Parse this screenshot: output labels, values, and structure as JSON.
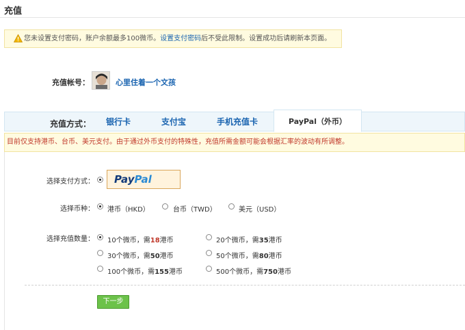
{
  "page": {
    "title": "充值"
  },
  "warning": {
    "icon": "warning-icon",
    "text_before": "您未设置支付密码，账户余额最多100微币。",
    "link": "设置支付密码",
    "text_after": "后不受此限制。设置成功后请刷新本页面。"
  },
  "account": {
    "label": "充值帐号：",
    "username": "心里住着一个文孩"
  },
  "methods": {
    "label": "充值方式：",
    "tabs": [
      {
        "label": "银行卡"
      },
      {
        "label": "支付宝"
      },
      {
        "label": "手机充值卡"
      },
      {
        "label": "PayPal（外币）"
      }
    ],
    "active_index": 3
  },
  "notice": "目前仅支持港币、台币、美元支付。由于通过外币支付的特殊性，充值所需金额可能会根据汇率的波动有所调整。",
  "payment": {
    "label": "选择支付方式：",
    "logo_pay": "Pay",
    "logo_pal": "Pal"
  },
  "currency": {
    "label": "选择币种：",
    "options": [
      "港币（HKD）",
      "台币（TWD）",
      "美元（USD）"
    ],
    "selected_index": 0
  },
  "amount": {
    "label": "选择充值数量：",
    "options": [
      {
        "count": "10",
        "unit": "个微币，需",
        "price": "18",
        "suffix": "港币"
      },
      {
        "count": "20",
        "unit": "个微币，需",
        "price": "35",
        "suffix": "港币"
      },
      {
        "count": "30",
        "unit": "个微币，需",
        "price": "50",
        "suffix": "港币"
      },
      {
        "count": "50",
        "unit": "个微币，需",
        "price": "80",
        "suffix": "港币"
      },
      {
        "count": "100",
        "unit": "个微币，需",
        "price": "155",
        "suffix": "港币"
      },
      {
        "count": "500",
        "unit": "个微币，需",
        "price": "750",
        "suffix": "港币"
      }
    ],
    "selected_index": 0
  },
  "next_button": "下一步",
  "colors": {
    "link": "#1a64b0",
    "alert": "#c0392b",
    "button": "#6cc24a"
  }
}
